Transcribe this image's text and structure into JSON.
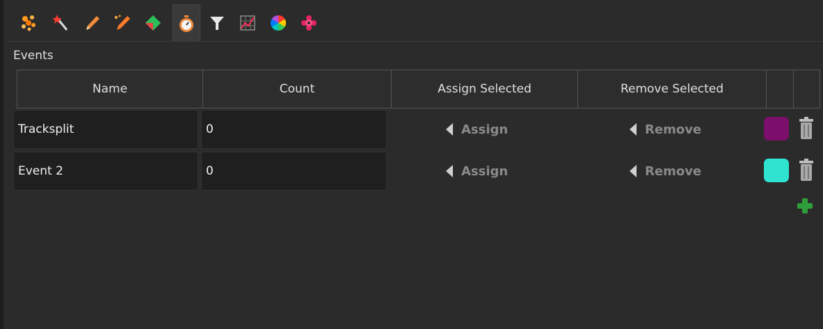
{
  "toolbar": {
    "tools": [
      {
        "icon": "particles-icon"
      },
      {
        "icon": "magic-wand-icon"
      },
      {
        "icon": "pencil-icon"
      },
      {
        "icon": "multi-pencil-icon"
      },
      {
        "icon": "tag-icon"
      },
      {
        "icon": "stopwatch-icon",
        "active": true
      },
      {
        "icon": "filter-icon"
      },
      {
        "icon": "chart-icon"
      },
      {
        "icon": "color-wheel-icon"
      },
      {
        "icon": "gear-flower-icon"
      }
    ]
  },
  "panel": {
    "title": "Events"
  },
  "table": {
    "columns": [
      "Name",
      "Count",
      "Assign Selected",
      "Remove Selected",
      "",
      ""
    ],
    "rows": [
      {
        "name": "Tracksplit",
        "count": "0",
        "assign_label": "Assign",
        "remove_label": "Remove",
        "color": "#7b0f6b"
      },
      {
        "name": "Event 2",
        "count": "0",
        "assign_label": "Assign",
        "remove_label": "Remove",
        "color": "#2fe3d1"
      }
    ]
  },
  "colors": {
    "window_bg": "#2b2b2b",
    "add_icon": "#2f9e3a"
  }
}
